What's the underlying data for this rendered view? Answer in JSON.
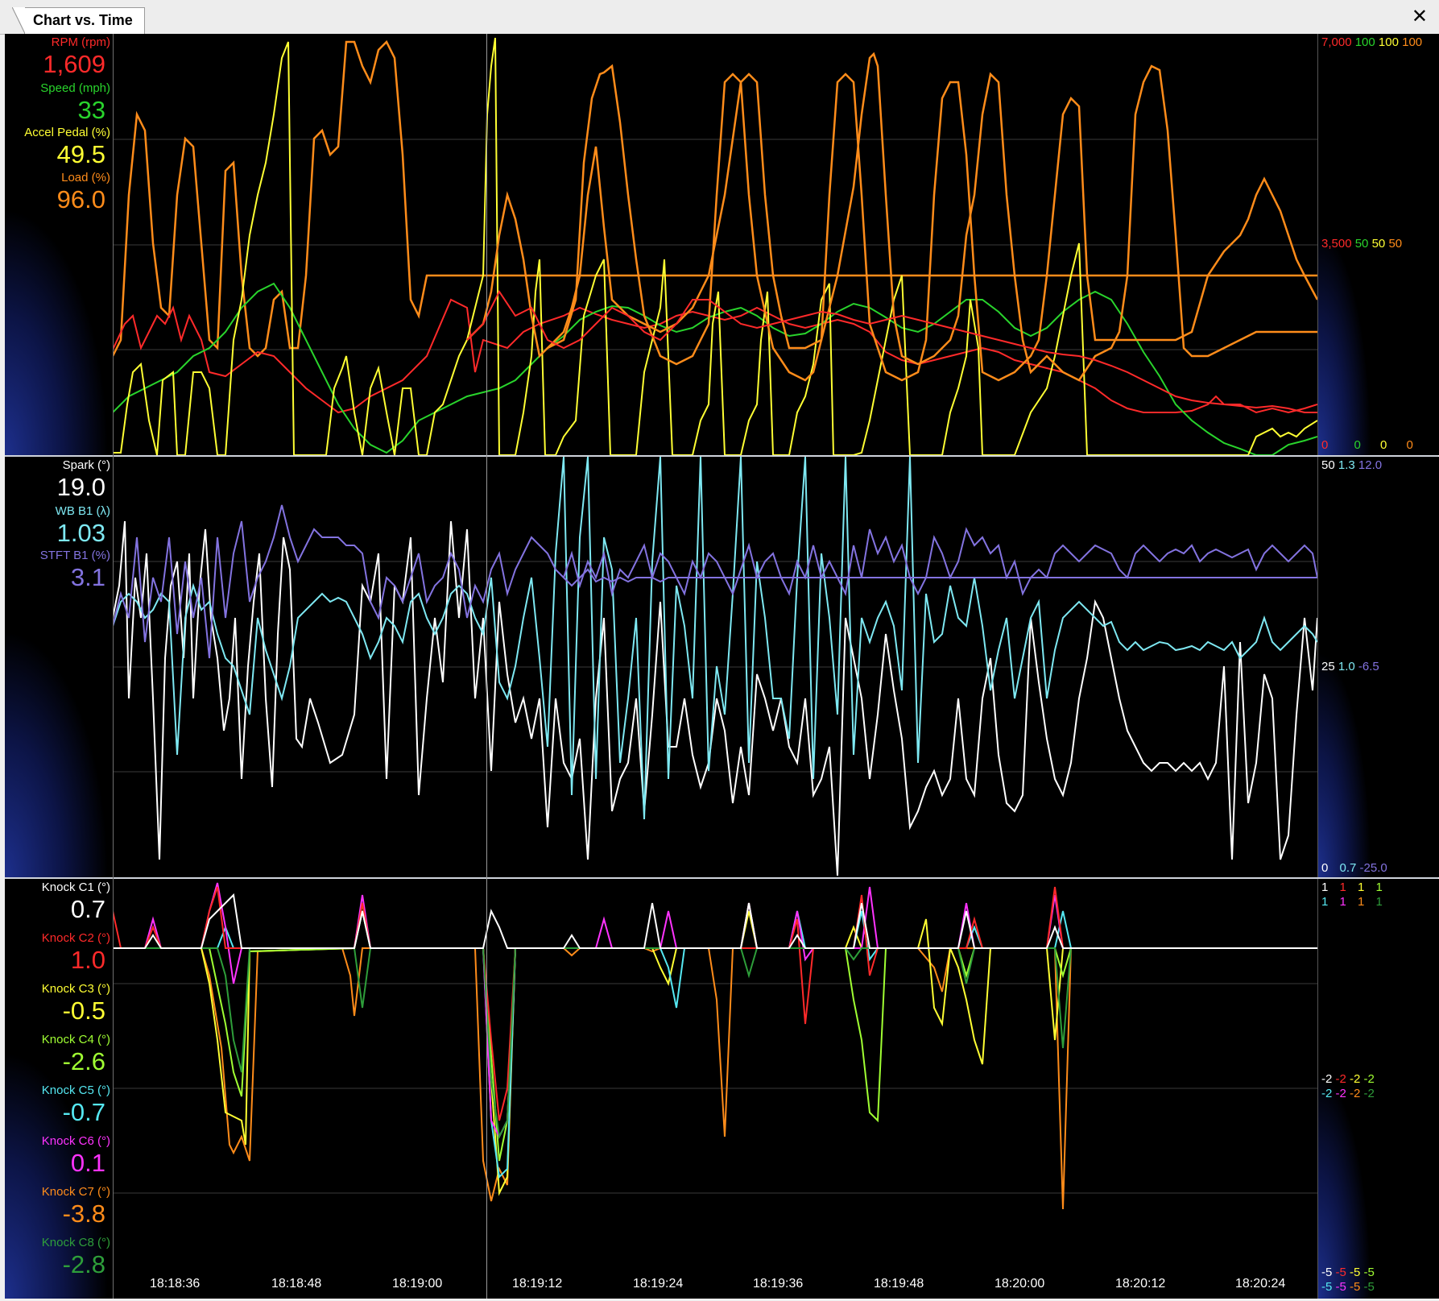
{
  "window": {
    "tab_title": "Chart vs. Time",
    "close_glyph": "✕"
  },
  "colors": {
    "rpm": "#ff2a2a",
    "speed": "#29d42c",
    "accel": "#ffff33",
    "load": "#ff8c1a",
    "spark": "#ffffff",
    "wb": "#7ee8f2",
    "stft": "#8373e0",
    "knock": [
      "#ffffff",
      "#ff2a2a",
      "#ffff33",
      "#a0ff33",
      "#55e8f2",
      "#ff33ff",
      "#ff8c1a",
      "#2e9e3a"
    ]
  },
  "panels": {
    "engine": {
      "params": [
        {
          "name": "RPM (rpm)",
          "value": "1,609"
        },
        {
          "name": "Speed (mph)",
          "value": "33"
        },
        {
          "name": "Accel Pedal (%)",
          "value": "49.5"
        },
        {
          "name": "Load (%)",
          "value": "96.0"
        }
      ],
      "scale": {
        "top": [
          "7,000",
          "100",
          "100",
          "100"
        ],
        "mid": [
          "3,500",
          "50",
          "50",
          "50"
        ],
        "bot": [
          "0",
          "0",
          "0",
          "0"
        ]
      }
    },
    "fuel": {
      "params": [
        {
          "name": "Spark (°)",
          "value": "19.0"
        },
        {
          "name": "WB B1 (λ)",
          "value": "1.03"
        },
        {
          "name": "STFT B1 (%)",
          "value": "3.1"
        }
      ],
      "scale": {
        "top": [
          "50",
          "1.3",
          "12.0"
        ],
        "mid": [
          "25",
          "1.0",
          "-6.5"
        ],
        "bot": [
          "0",
          "0.7",
          "-25.0"
        ]
      }
    },
    "knock": {
      "params": [
        {
          "name": "Knock C1 (°)",
          "value": "0.7"
        },
        {
          "name": "Knock C2 (°)",
          "value": "1.0"
        },
        {
          "name": "Knock C3 (°)",
          "value": "-0.5"
        },
        {
          "name": "Knock C4 (°)",
          "value": "-2.6"
        },
        {
          "name": "Knock C5 (°)",
          "value": "-0.7"
        },
        {
          "name": "Knock C6 (°)",
          "value": "0.1"
        },
        {
          "name": "Knock C7 (°)",
          "value": "-3.8"
        },
        {
          "name": "Knock C8 (°)",
          "value": "-2.8"
        }
      ],
      "scale": {
        "top1": [
          "1",
          "1",
          "1",
          "1"
        ],
        "top2": [
          "1",
          "1",
          "1",
          "1"
        ],
        "mid1": [
          "-2",
          "-2",
          "-2",
          "-2"
        ],
        "mid2": [
          "-2",
          "-2",
          "-2",
          "-2"
        ],
        "bot1": [
          "-5",
          "-5",
          "-5",
          "-5"
        ],
        "bot2": [
          "-5",
          "-5",
          "-5",
          "-5"
        ]
      }
    }
  },
  "time_axis": [
    "18:18:36",
    "18:18:48",
    "18:19:00",
    "18:19:12",
    "18:19:24",
    "18:19:36",
    "18:19:48",
    "18:20:00",
    "18:20:12",
    "18:20:24"
  ],
  "cursor_time": "18:19:07"
}
